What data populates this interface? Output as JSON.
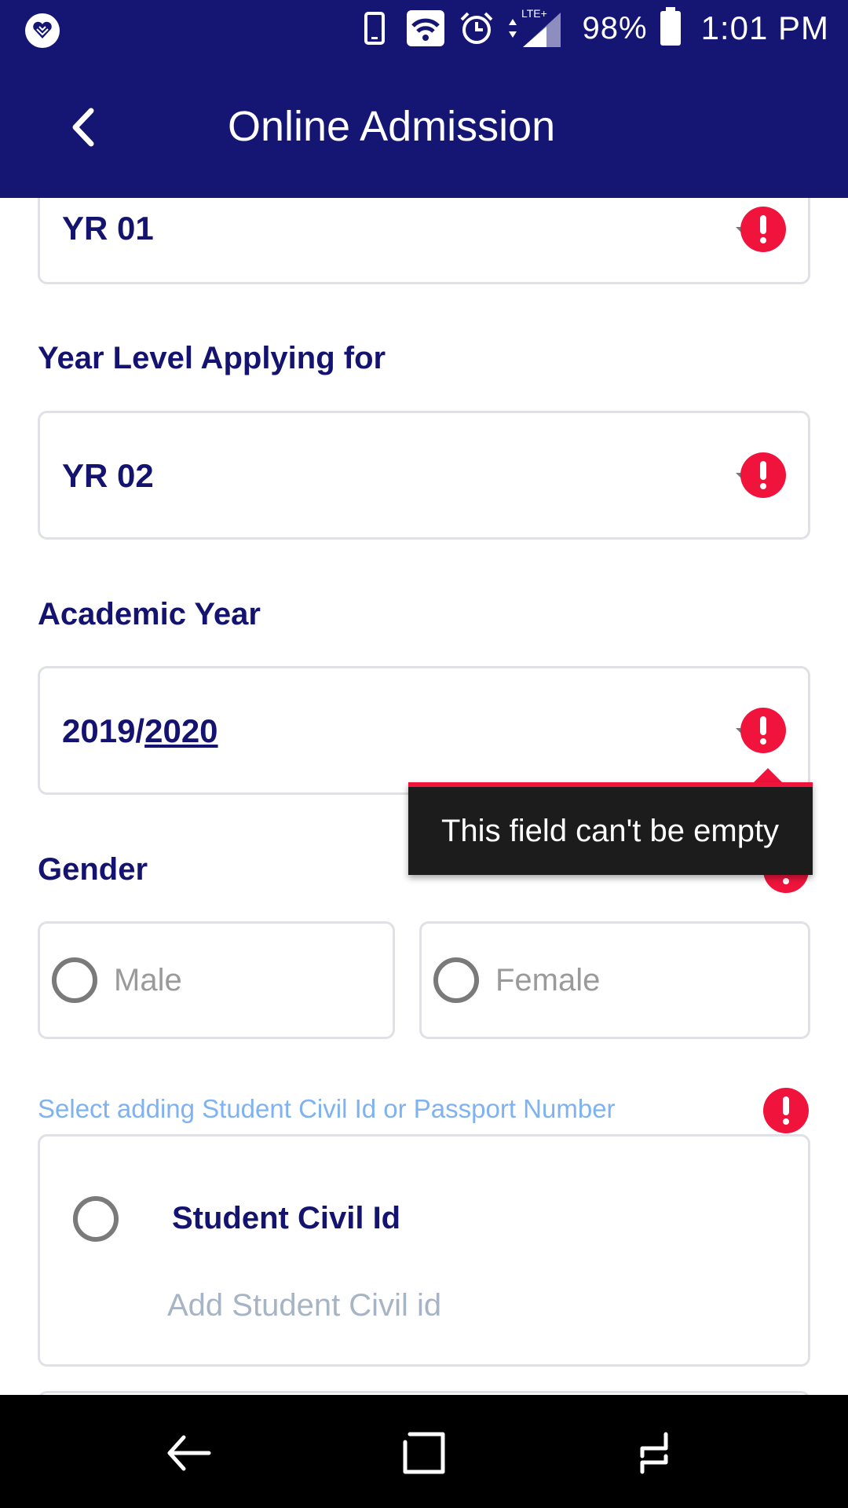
{
  "status_bar": {
    "battery_percent": "98%",
    "time": "1:01 PM",
    "network": "LTE+",
    "icons": [
      "app-heart-icon",
      "phone-icon",
      "wifi-icon",
      "alarm-icon",
      "signal-icon",
      "battery-icon"
    ]
  },
  "toolbar": {
    "title": "Online Admission",
    "back_icon": "chevron-left-icon"
  },
  "form": {
    "current_year_level": {
      "value": "YR 01"
    },
    "year_level_applying": {
      "label": "Year Level Applying for",
      "value": "YR 02"
    },
    "academic_year": {
      "label": "Academic Year",
      "value_prefix": "2019/",
      "value_suffix": "2020"
    },
    "gender": {
      "label": "Gender",
      "options": [
        "Male",
        "Female"
      ]
    },
    "id_choice": {
      "hint": "Select adding Student Civil Id or Passport Number",
      "civil_id_label": "Student Civil Id",
      "civil_id_placeholder": "Add Student Civil id"
    }
  },
  "tooltip": {
    "text": "This field can't be empty"
  },
  "colors": {
    "header": "#151574",
    "text": "#141470",
    "error": "#f0143c",
    "hint": "#7eb2f0",
    "border": "#dfe1e6"
  },
  "navbar": {
    "icons": [
      "nav-back-icon",
      "nav-home-icon",
      "nav-recents-icon"
    ]
  }
}
